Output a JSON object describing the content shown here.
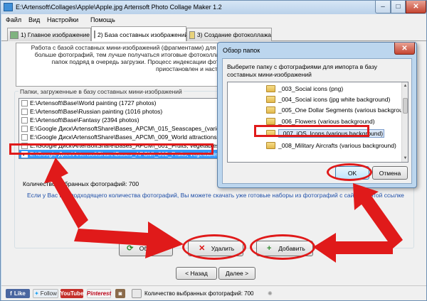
{
  "window": {
    "title": "E:\\Artensoft\\Collages\\Apple\\Apple.jpg Artensoft Photo Collage Maker 1.2",
    "min_glyph": "–",
    "max_glyph": "□",
    "close_glyph": "✕"
  },
  "menu": [
    "Файл",
    "Вид",
    "Настройки",
    "Помощь"
  ],
  "tabs": [
    {
      "label": "1) Главное изображение"
    },
    {
      "label": "2) База составных изображений"
    },
    {
      "label": "3) Создание фотоколлажа"
    }
  ],
  "info_text": "Работа с базой составных мини-изображений (фрагментами) для фотоколлажа. Индексация может занять некоторое время. Чем больше фотографий, тем лучше получаться итоговые фотоколлажи (рекомендуется начать эксперименты добавить несколько папок подряд в очередь загрузки. Процесс индексации фотоколлаж можно в том случае, если процесс индексации приостановлен и настройках программы.",
  "group_label": "Папки, загруженные в базу составных мини-изображений",
  "folders": [
    {
      "path": "E:\\Artensoft\\Base\\World painting (1727 photos)",
      "checked": false,
      "selected": false
    },
    {
      "path": "E:\\Artensoft\\Base\\Russian painting (1016 photos)",
      "checked": false,
      "selected": false
    },
    {
      "path": "E:\\Artensoft\\Base\\Fantasy (2394 photos)",
      "checked": false,
      "selected": false
    },
    {
      "path": "E:\\Google Диск\\ArtensoftShare\\Bases_APCM\\_015_Seascapes_(various background)",
      "checked": false,
      "selected": false
    },
    {
      "path": "E:\\Google Диск\\ArtensoftShare\\Bases_APCM\\_009_World attractions (1996 photos)",
      "checked": false,
      "selected": false
    },
    {
      "path": "E:\\Google Диск\\ArtensoftShare\\Bases_APCM\\_001_Fruits, vegetables (white background)",
      "checked": false,
      "selected": false
    },
    {
      "path": "E:\\Google Диск\\ArtensoftShare\\Bases_APCM\\_002_Fruits, vegetables (various background)",
      "checked": true,
      "selected": true
    }
  ],
  "selected_count_label": "Количество выбранных фотографий: 700",
  "download_hint": "Если у Вас нет подходящего количества фотографий, Вы можете скачать уже готовые наборы из фотографий с сайта по этой ссылке",
  "buttons": {
    "refresh": "Обновить",
    "delete": "Удалить",
    "add": "Добавить",
    "back": "< Назад",
    "next": "Далее >"
  },
  "statusbar": {
    "like": "Like",
    "follow": "Follow",
    "youtube": "YouTube",
    "pinterest": "Pinterest",
    "count": "Количество выбранных фотографий: 700"
  },
  "dialog": {
    "title": "Обзор папок",
    "close_glyph": "✕",
    "prompt": "Выберите папку с фотографиями для импорта в базу составных мини-изображений",
    "folders": [
      {
        "name": "_003_Social icons (png)",
        "highlight": false
      },
      {
        "name": "_004_Social icons (jpg white background)",
        "highlight": false
      },
      {
        "name": "_005_One Dollar Segments (various background)",
        "highlight": false
      },
      {
        "name": "_006_Flowers (various background)",
        "highlight": false
      },
      {
        "name": "_007_iOS_Icons (various background)",
        "highlight": true
      },
      {
        "name": "_008_Military Aircrafts (various background)",
        "highlight": false
      }
    ],
    "ok": "OK",
    "cancel": "Отмена"
  },
  "colors": {
    "annotation_red": "#e01a1a",
    "selection_blue": "#3399ff",
    "window_frame": "#bcd6ee"
  }
}
